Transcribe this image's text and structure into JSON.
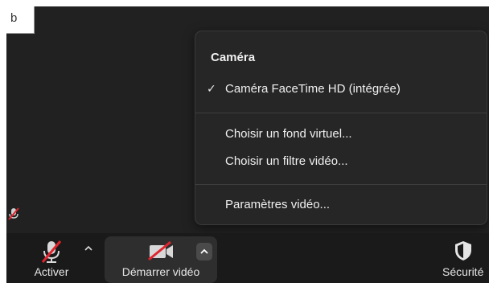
{
  "panel_label": "b",
  "menu": {
    "title": "Caméra",
    "items": [
      {
        "label": "Caméra FaceTime HD (intégrée)",
        "checked": true
      },
      {
        "label": "Choisir un fond virtuel..."
      },
      {
        "label": "Choisir un filtre vidéo..."
      },
      {
        "label": "Paramètres vidéo..."
      }
    ]
  },
  "toolbar": {
    "audio_label": "Activer",
    "video_label": "Démarrer vidéo",
    "security_label": "Sécurité"
  },
  "colors": {
    "mute_slash": "#e0242d",
    "background": "#212121",
    "menu_bg": "#262626"
  },
  "icons": [
    "microphone-muted-icon",
    "camera-off-icon",
    "shield-icon",
    "chevron-up-icon",
    "checkmark-icon"
  ]
}
